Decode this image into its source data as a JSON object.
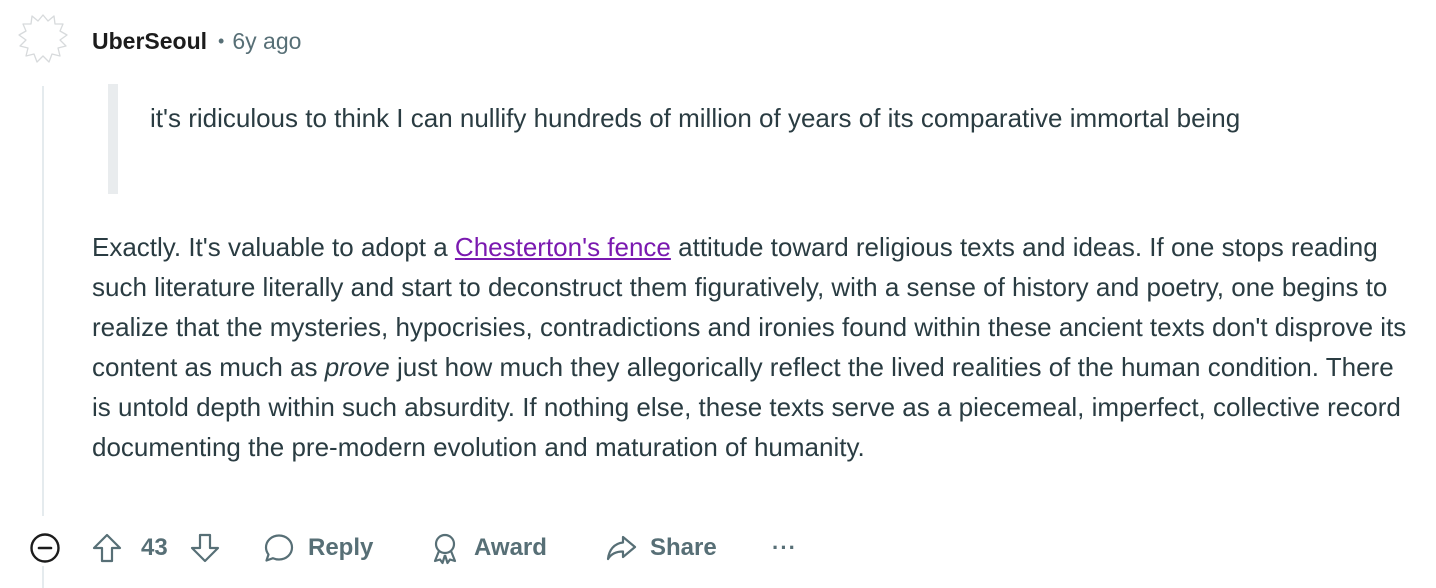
{
  "comment": {
    "author": "UberSeoul",
    "separator": "•",
    "timestamp": "6y ago",
    "quote": "it's ridiculous to think I can nullify hundreds of million of years of its comparative immortal being",
    "body": {
      "before_link": "Exactly. It's valuable to adopt a ",
      "link_text": "Chesterton's fence",
      "after_link": " attitude toward religious texts and ideas. If one stops reading such literature literally and start to deconstruct them figuratively, with a sense of history and poetry, one begins to realize that the mysteries, hypocrisies, contradictions and ironies found within these ancient texts don't disprove its content as much as ",
      "emphasis": "prove",
      "after_emphasis": " just how much they allegorically reflect the lived realities of the human condition. There is untold depth within such absurdity. If nothing else, these texts serve as a piecemeal, imperfect, collective record documenting the pre-modern evolution and maturation of humanity."
    },
    "link_color": "#7a19b0"
  },
  "actions": {
    "vote_count": "43",
    "reply_label": "Reply",
    "award_label": "Award",
    "share_label": "Share",
    "more_label": "···"
  },
  "icons": {
    "avatar": "snoo-outline-avatar-icon",
    "collapse": "collapse-minus-circle-icon",
    "upvote": "upvote-arrow-icon",
    "downvote": "downvote-arrow-icon",
    "reply": "speech-bubble-icon",
    "award": "award-ribbon-icon",
    "share": "share-arrow-icon",
    "more": "ellipsis-icon"
  }
}
